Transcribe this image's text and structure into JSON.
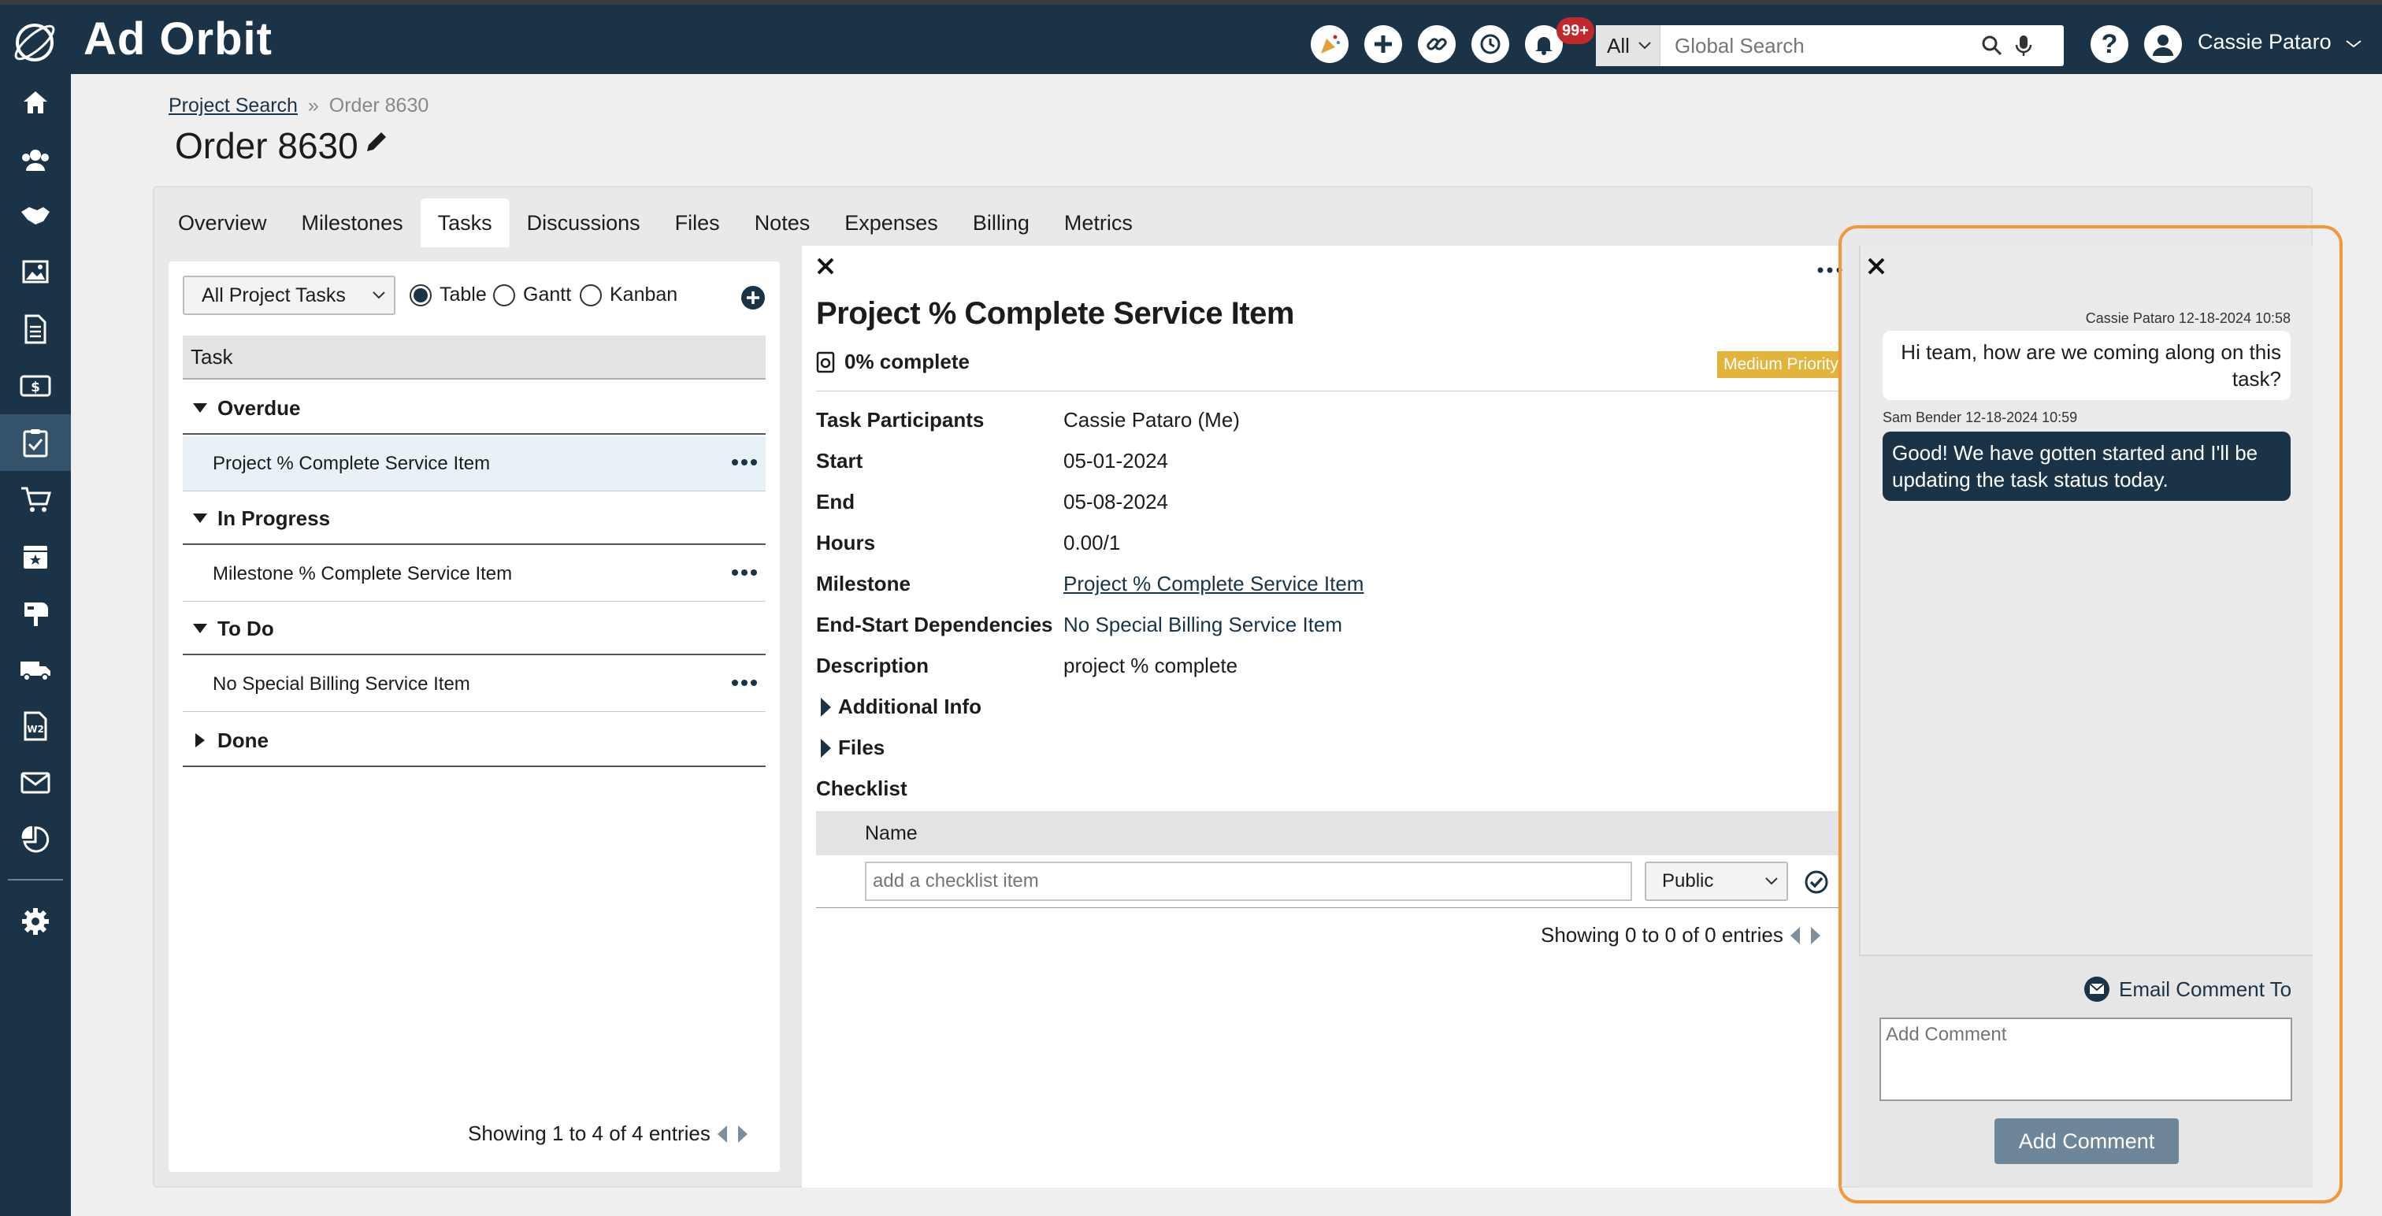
{
  "app": {
    "logo_text": "Ad Orbit"
  },
  "topbar": {
    "notification_badge": "99+",
    "search_scope": "All",
    "search_placeholder": "Global Search",
    "user_name": "Cassie Pataro"
  },
  "sidebar": {
    "items": [
      "home-icon",
      "contacts-icon",
      "handshake-icon",
      "media-icon",
      "document-icon",
      "billing-icon",
      "tasks-icon",
      "cart-icon",
      "calendar-icon",
      "mailbox-icon",
      "truck-icon",
      "w2-icon",
      "mail-icon",
      "reports-icon",
      "settings-icon"
    ]
  },
  "breadcrumb": {
    "parent": "Project Search",
    "separator": "»",
    "current": "Order 8630"
  },
  "page_title": "Order 8630",
  "tabs": [
    "Overview",
    "Milestones",
    "Tasks",
    "Discussions",
    "Files",
    "Notes",
    "Expenses",
    "Billing",
    "Metrics"
  ],
  "task_panel": {
    "filter_select": "All Project Tasks",
    "views": [
      "Table",
      "Gantt",
      "Kanban"
    ],
    "selected_view": "Table",
    "column_header": "Task",
    "groups": [
      {
        "name": "Overdue",
        "expanded": true,
        "tasks": [
          "Project % Complete Service Item"
        ]
      },
      {
        "name": "In Progress",
        "expanded": true,
        "tasks": [
          "Milestone % Complete Service Item"
        ]
      },
      {
        "name": "To Do",
        "expanded": true,
        "tasks": [
          "No Special Billing Service Item"
        ]
      },
      {
        "name": "Done",
        "expanded": false,
        "tasks": []
      }
    ],
    "pager_text": "Showing 1 to 4 of 4 entries"
  },
  "detail": {
    "title": "Project % Complete Service Item",
    "percent_complete": "0% complete",
    "priority": "Medium Priority",
    "fields": {
      "participants_label": "Task Participants",
      "participants": "Cassie Pataro (Me)",
      "start_label": "Start",
      "start": "05-01-2024",
      "end_label": "End",
      "end": "05-08-2024",
      "hours_label": "Hours",
      "hours": "0.00/1",
      "milestone_label": "Milestone",
      "milestone": "Project % Complete Service Item",
      "deps_label": "End-Start Dependencies",
      "deps": "No Special Billing Service Item",
      "description_label": "Description",
      "description": "project % complete"
    },
    "additional_info": "Additional Info",
    "files": "Files",
    "checklist": {
      "title": "Checklist",
      "column_name": "Name",
      "input_placeholder": "add a checklist item",
      "visibility": "Public",
      "pager_text": "Showing 0 to 0 of 0 entries"
    }
  },
  "comments": {
    "messages": [
      {
        "author": "Cassie Pataro",
        "time": "12-18-2024 10:58",
        "text": "Hi team, how are we coming along on this task?",
        "mine": true
      },
      {
        "author": "Sam Bender",
        "time": "12-18-2024 10:59",
        "text": "Good! We have gotten started and I'll be updating the task status today.",
        "mine": false
      }
    ],
    "email_to_label": "Email Comment To",
    "input_placeholder": "Add Comment",
    "submit_label": "Add Comment"
  },
  "colors": {
    "navy": "#1a3347",
    "highlight": "#f0993a",
    "priority": "#e3b43c"
  }
}
